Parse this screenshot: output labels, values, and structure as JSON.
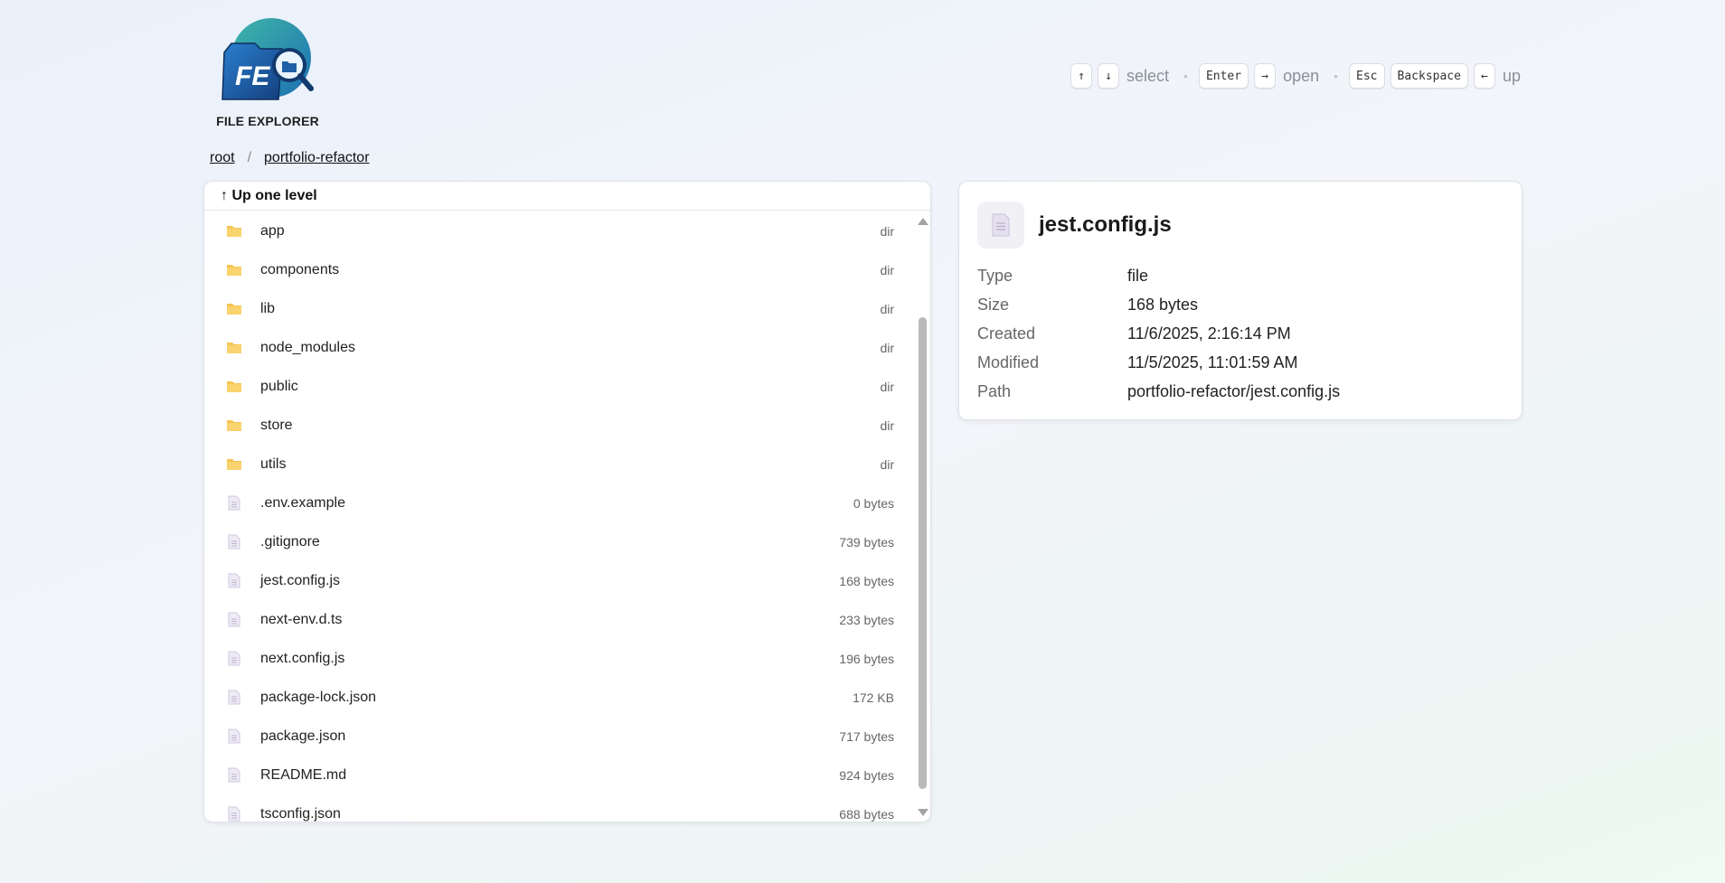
{
  "logo": {
    "caption": "FILE EXPLORER",
    "mark": "FE"
  },
  "hints": [
    {
      "keys": [
        "↑",
        "↓"
      ],
      "label": "select"
    },
    {
      "keys": [
        "Enter",
        "→"
      ],
      "label": "open"
    },
    {
      "keys": [
        "Esc",
        "Backspace",
        "←"
      ],
      "label": "up"
    }
  ],
  "breadcrumb": {
    "items": [
      "root",
      "portfolio-refactor"
    ],
    "separator": "/"
  },
  "file_list": {
    "up_label": "↑ Up one level",
    "rows": [
      {
        "name": "app",
        "meta": "dir",
        "kind": "folder"
      },
      {
        "name": "components",
        "meta": "dir",
        "kind": "folder"
      },
      {
        "name": "lib",
        "meta": "dir",
        "kind": "folder"
      },
      {
        "name": "node_modules",
        "meta": "dir",
        "kind": "folder"
      },
      {
        "name": "public",
        "meta": "dir",
        "kind": "folder"
      },
      {
        "name": "store",
        "meta": "dir",
        "kind": "folder"
      },
      {
        "name": "utils",
        "meta": "dir",
        "kind": "folder"
      },
      {
        "name": ".env.example",
        "meta": "0 bytes",
        "kind": "file"
      },
      {
        "name": ".gitignore",
        "meta": "739 bytes",
        "kind": "file"
      },
      {
        "name": "jest.config.js",
        "meta": "168 bytes",
        "kind": "file"
      },
      {
        "name": "next-env.d.ts",
        "meta": "233 bytes",
        "kind": "file"
      },
      {
        "name": "next.config.js",
        "meta": "196 bytes",
        "kind": "file"
      },
      {
        "name": "package-lock.json",
        "meta": "172 KB",
        "kind": "file"
      },
      {
        "name": "package.json",
        "meta": "717 bytes",
        "kind": "file"
      },
      {
        "name": "README.md",
        "meta": "924 bytes",
        "kind": "file"
      },
      {
        "name": "tsconfig.json",
        "meta": "688 bytes",
        "kind": "file"
      }
    ]
  },
  "details": {
    "title": "jest.config.js",
    "rows": [
      {
        "label": "Type",
        "value": "file"
      },
      {
        "label": "Size",
        "value": "168 bytes"
      },
      {
        "label": "Created",
        "value": "11/6/2025, 2:16:14 PM"
      },
      {
        "label": "Modified",
        "value": "11/5/2025, 11:01:59 AM"
      },
      {
        "label": "Path",
        "value": "portfolio-refactor/jest.config.js"
      }
    ]
  },
  "colors": {
    "folder": "#f5c451",
    "file_icon": "#c9c3dc",
    "logo_blue": "#1f5fa8",
    "logo_teal": "#2a9d9a"
  }
}
